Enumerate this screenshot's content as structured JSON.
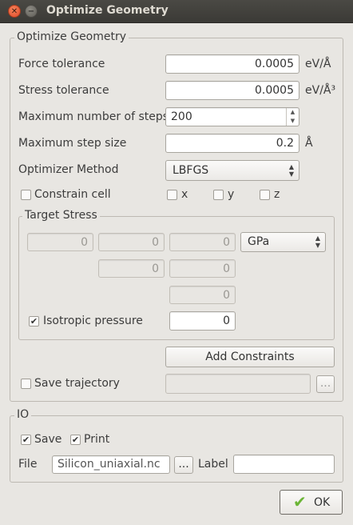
{
  "window": {
    "title": "Optimize Geometry"
  },
  "main_group": {
    "legend": "Optimize Geometry",
    "force_tolerance": {
      "label": "Force tolerance",
      "value": "0.0005",
      "unit": "eV/Å"
    },
    "stress_tolerance": {
      "label": "Stress tolerance",
      "value": "0.0005",
      "unit": "eV/Å³"
    },
    "max_steps": {
      "label": "Maximum number of steps",
      "value": "200"
    },
    "max_step_size": {
      "label": "Maximum step size",
      "value": "0.2",
      "unit": "Å"
    },
    "optimizer_method": {
      "label": "Optimizer Method",
      "value": "LBFGS"
    },
    "constrain_cell": {
      "label": "Constrain cell",
      "x": "x",
      "y": "y",
      "z": "z"
    },
    "target_stress": {
      "legend": "Target Stress",
      "matrix": [
        "0",
        "0",
        "0",
        "0",
        "0",
        "0"
      ],
      "unit": "GPa",
      "isotropic_label": "Isotropic pressure",
      "isotropic_value": "0"
    },
    "add_constraints": "Add Constraints",
    "save_trajectory": {
      "label": "Save trajectory",
      "browse": "..."
    }
  },
  "io_group": {
    "legend": "IO",
    "save": "Save",
    "print": "Print",
    "file_label": "File",
    "file_value": "Silicon_uniaxial.nc",
    "browse": "...",
    "label_label": "Label",
    "label_value": ""
  },
  "ok_button": "OK"
}
